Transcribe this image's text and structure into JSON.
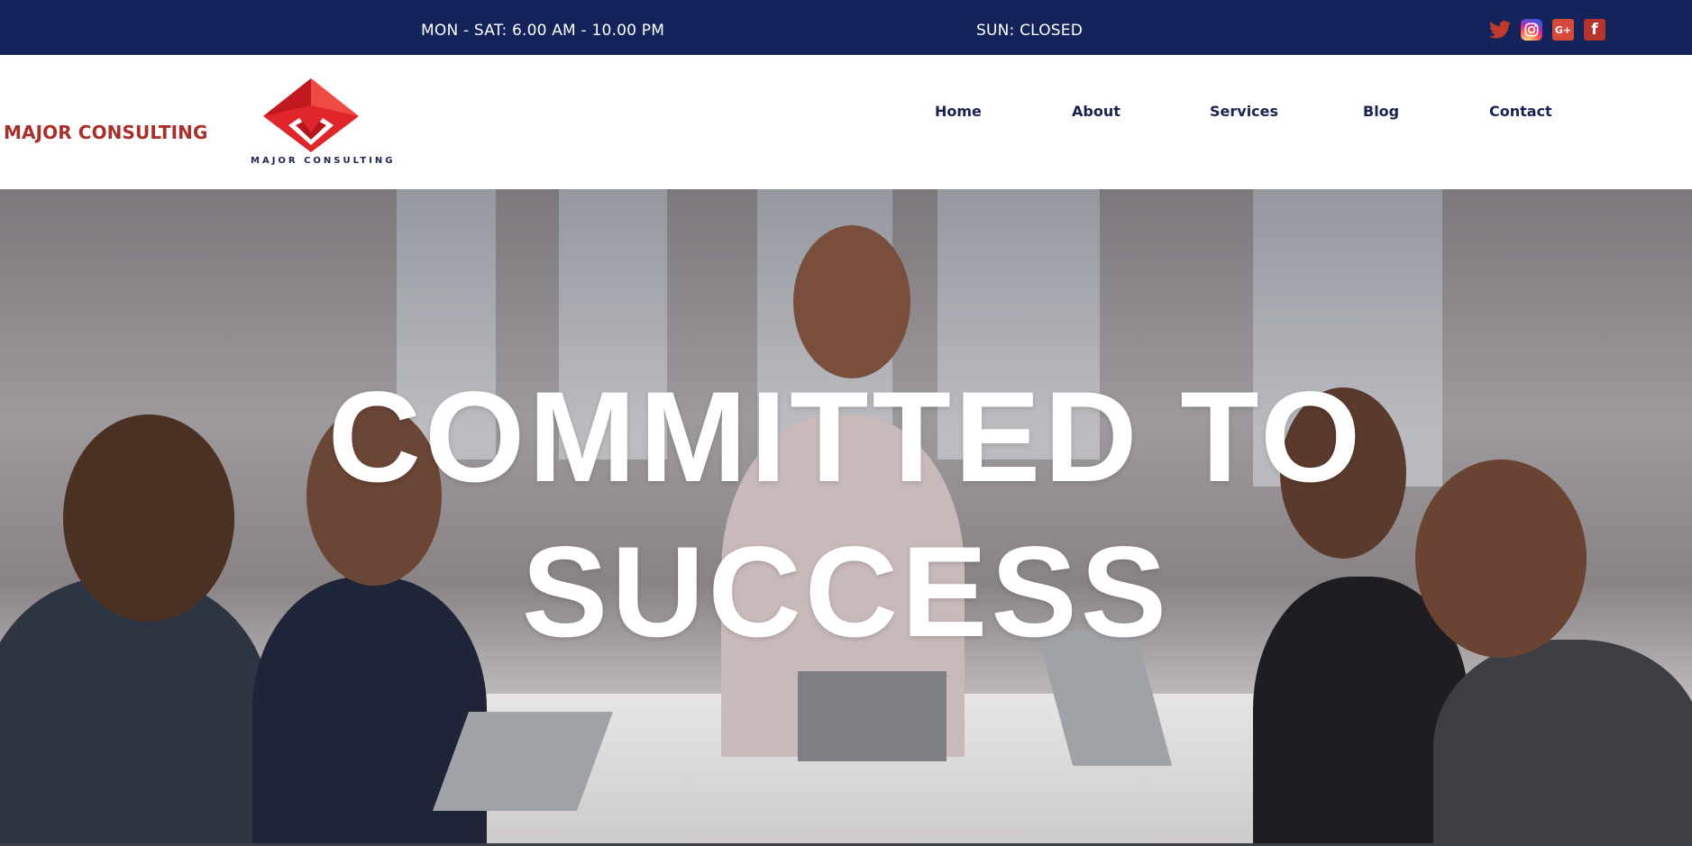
{
  "topbar": {
    "weekday_hours": "MON - SAT: 6.00 AM - 10.00 PM",
    "sunday_hours": "SUN: CLOSED",
    "background": "#14245a",
    "social_icons": [
      "twitter-icon",
      "instagram-icon",
      "google-plus-icon",
      "facebook-icon"
    ]
  },
  "header": {
    "brand_text": "MAJOR CONSULTING",
    "logo_caption": "MAJOR CONSULTING",
    "brand_color": "#a8302a",
    "logo_color": "#e0262b"
  },
  "nav": {
    "items": [
      {
        "label": "Home"
      },
      {
        "label": "About"
      },
      {
        "label": "Services"
      },
      {
        "label": "Blog"
      },
      {
        "label": "Contact"
      }
    ]
  },
  "hero": {
    "title_line1": "COMMITTED TO",
    "title_line2": "SUCCESS",
    "image": "business-team-meeting-photo"
  }
}
